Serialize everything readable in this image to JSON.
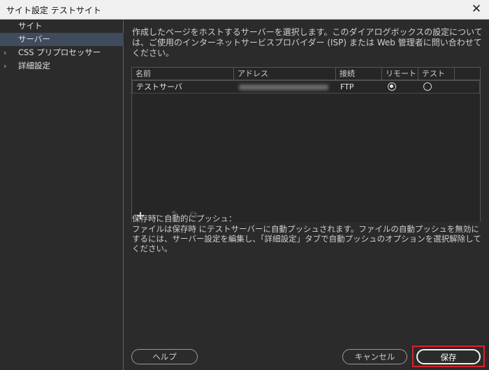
{
  "window": {
    "title": "サイト設定 テストサイト"
  },
  "sidebar": {
    "items": [
      {
        "label": "サイト"
      },
      {
        "label": "サーバー"
      },
      {
        "label": "CSS プリプロセッサー"
      },
      {
        "label": "詳細設定"
      }
    ]
  },
  "main": {
    "description": "作成したページをホストするサーバーを選択します。このダイアログボックスの設定については、ご使用のインターネットサービスプロバイダー (ISP) または Web 管理者に問い合わせてください。",
    "table": {
      "columns": [
        "名前",
        "アドレス",
        "接続",
        "リモート",
        "テスト"
      ],
      "rows": [
        {
          "name": "テストサーバ",
          "connection": "FTP",
          "remote": true,
          "test": false
        }
      ]
    },
    "auto_push_heading": "保存時に自動的にプッシュ：",
    "auto_push_text": "ファイルは保存時 にテストサーバーに自動プッシュされます。ファイルの自動プッシュを無効にするには、サーバー設定を編集し、「詳細設定」タブで自動プッシュのオプションを選択解除してください。"
  },
  "buttons": {
    "help": "ヘルプ",
    "cancel": "キャンセル",
    "save": "保存"
  },
  "colors": {
    "selection": "#3f4c5e",
    "highlight": "#d8232a"
  }
}
